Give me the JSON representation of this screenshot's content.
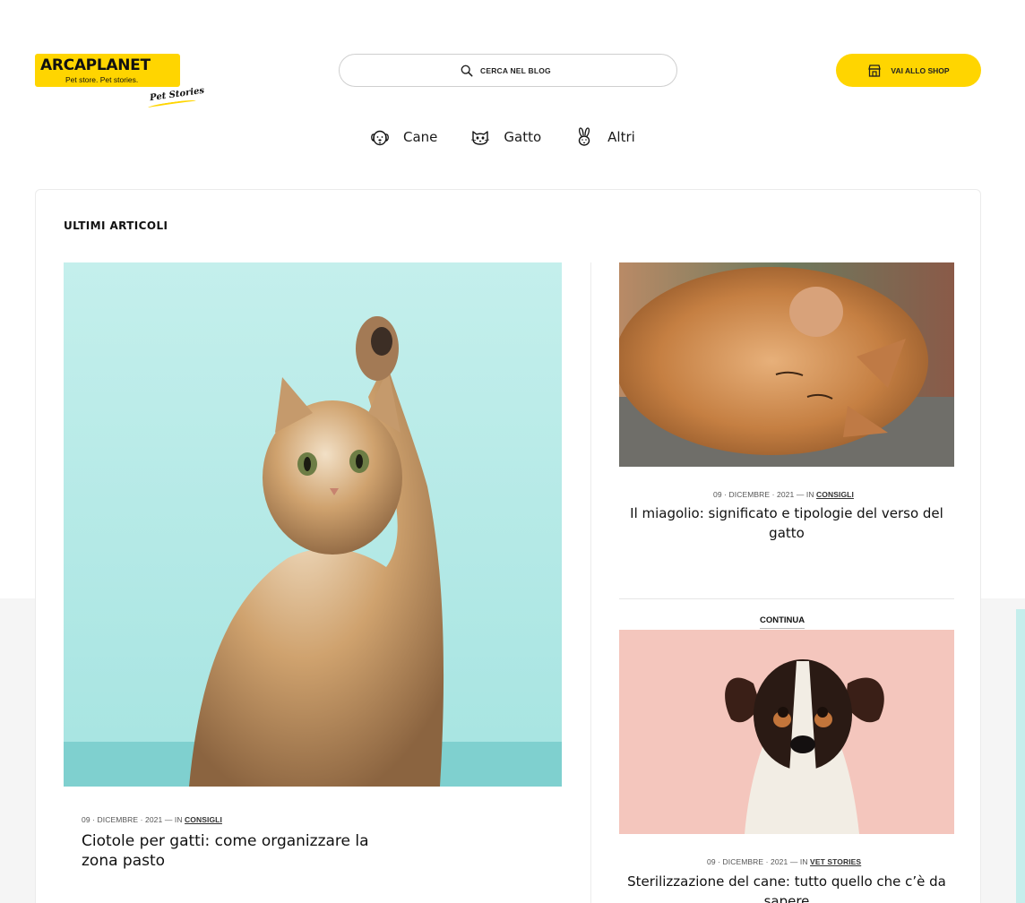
{
  "logo": {
    "brand": "ARCAPLANET",
    "tagline": "Pet store. Pet stories.",
    "sub": "Pet Stories"
  },
  "search": {
    "placeholder": "CERCA NEL BLOG"
  },
  "shop_button": {
    "label": "VAI ALLO SHOP"
  },
  "nav": [
    {
      "label": "Cane",
      "icon": "dog-icon"
    },
    {
      "label": "Gatto",
      "icon": "cat-icon"
    },
    {
      "label": "Altri",
      "icon": "rabbit-icon"
    }
  ],
  "section_title": "ULTIMI ARTICOLI",
  "articles": [
    {
      "date": "09 · DICEMBRE · 2021",
      "in": "— IN",
      "category": "CONSIGLI",
      "title": "Ciotole per gatti: come organizzare la zona pasto"
    },
    {
      "date": "09 · DICEMBRE · 2021",
      "in": "— IN",
      "category": "CONSIGLI",
      "title": "Il miagolio: significato e tipologie del verso del gatto"
    },
    {
      "date": "09 · DICEMBRE · 2021",
      "in": "— IN",
      "category": "VET STORIES",
      "title": "Sterilizzazione del cane: tutto quello che c’è da sapere"
    }
  ],
  "continua_label": "CONTINUA",
  "colors": {
    "brand_yellow": "#ffd500",
    "kitten_bg": "#bdeeea",
    "dog_bg": "#f4c6bd"
  }
}
